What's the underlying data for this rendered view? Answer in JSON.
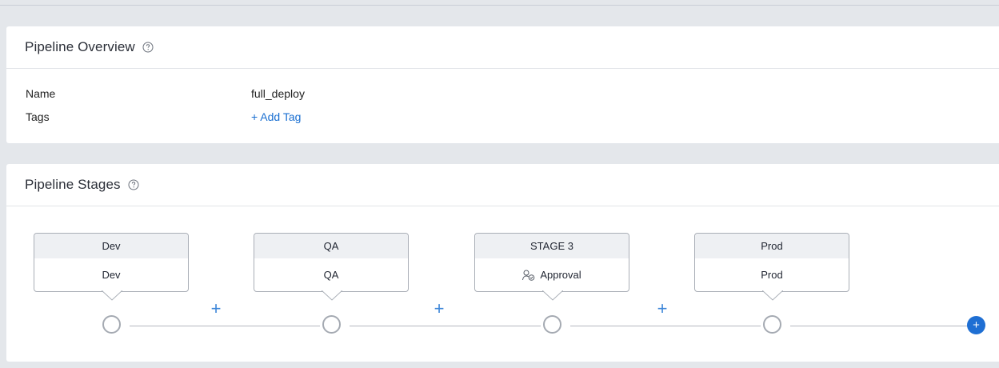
{
  "overview": {
    "title": "Pipeline Overview",
    "fields": [
      {
        "label": "Name",
        "value": "full_deploy"
      },
      {
        "label": "Tags",
        "value": "+ Add Tag"
      }
    ]
  },
  "stages_panel": {
    "title": "Pipeline Stages",
    "stages": [
      {
        "header": "Dev",
        "body": "Dev"
      },
      {
        "header": "QA",
        "body": "QA"
      },
      {
        "header": "STAGE 3",
        "body": "Approval",
        "body_icon": "approval-icon"
      },
      {
        "header": "Prod",
        "body": "Prod"
      }
    ],
    "insert_symbol": "+",
    "add_stage_symbol": "+"
  },
  "colors": {
    "background": "#e4e7eb",
    "card": "#ffffff",
    "link": "#1a6fd1",
    "accent": "#1f6fd3",
    "node_border": "#a5aab2"
  }
}
